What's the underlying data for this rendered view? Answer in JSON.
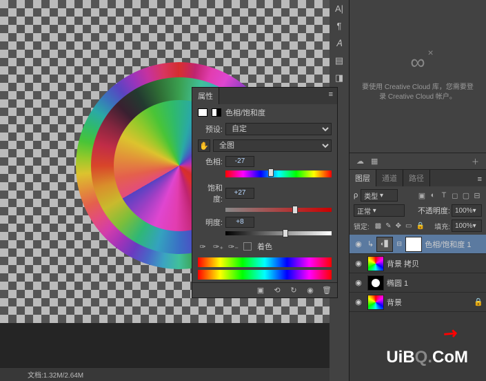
{
  "cc": {
    "line1": "要使用 Creative Cloud 库，您需要登",
    "line2": "录 Creative Cloud 帐户。"
  },
  "props": {
    "tab": "属性",
    "title": "色相/饱和度",
    "preset_label": "预设:",
    "preset_value": "自定",
    "range_value": "全图",
    "hue_label": "色相:",
    "hue_value": "-27",
    "sat_label": "饱和度:",
    "sat_value": "+27",
    "lig_label": "明度:",
    "lig_value": "+8",
    "colorize": "着色"
  },
  "layers_panel": {
    "tabs": [
      "图层",
      "通道",
      "路径"
    ],
    "filter": "类型",
    "blend": "正常",
    "opacity_label": "不透明度:",
    "opacity_value": "100%",
    "lock_label": "锁定:",
    "fill_label": "填充:",
    "fill_value": "100%",
    "layers": [
      {
        "name": "色相/饱和度 1"
      },
      {
        "name": "背景 拷贝"
      },
      {
        "name": "椭圆 1"
      },
      {
        "name": "背景"
      }
    ]
  },
  "status": "文档:1.32M/2.64M",
  "watermark": {
    "a": "UiB",
    "b": "Q.",
    "c": "CoM"
  }
}
